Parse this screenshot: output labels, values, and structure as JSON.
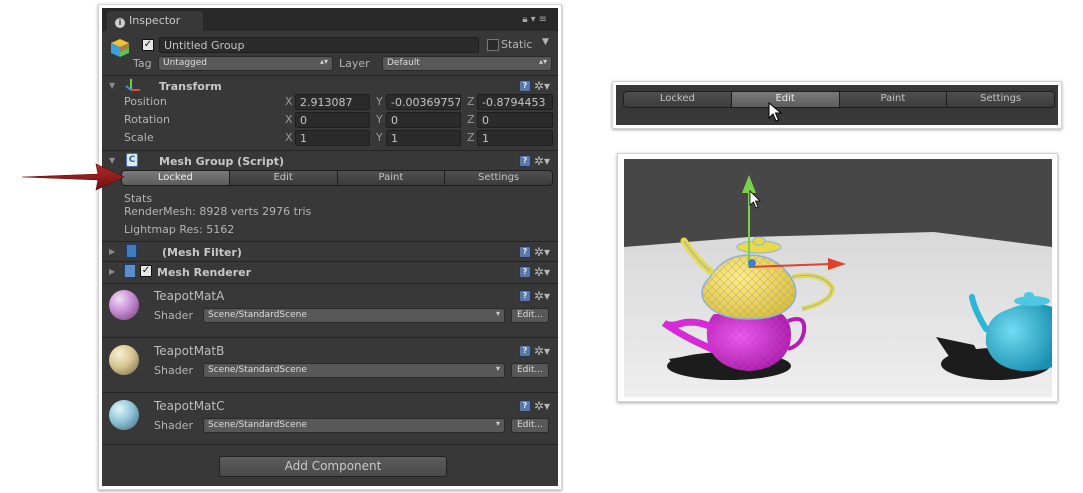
{
  "inspector": {
    "tab_label": "Inspector",
    "gameobject": {
      "name": "Untitled Group",
      "static_label": "Static",
      "tag_label": "Tag",
      "tag_value": "Untagged",
      "layer_label": "Layer",
      "layer_value": "Default"
    },
    "transform": {
      "title": "Transform",
      "position_label": "Position",
      "rotation_label": "Rotation",
      "scale_label": "Scale",
      "axis_x": "X",
      "axis_y": "Y",
      "axis_z": "Z",
      "position": {
        "x": "2.913087",
        "y": "-0.00369757",
        "z": "-0.8794453"
      },
      "rotation": {
        "x": "0",
        "y": "0",
        "z": "0"
      },
      "scale": {
        "x": "1",
        "y": "1",
        "z": "1"
      }
    },
    "mesh_group": {
      "title": "Mesh Group (Script)",
      "modes": [
        "Locked",
        "Edit",
        "Paint",
        "Settings"
      ],
      "active_mode": "Locked",
      "stats_label": "Stats",
      "render_mesh": "RenderMesh: 8928 verts 2976 tris",
      "lightmap_res": "Lightmap Res: 5162"
    },
    "mesh_filter": {
      "title": "(Mesh Filter)"
    },
    "mesh_renderer": {
      "title": "Mesh Renderer"
    },
    "materials": [
      {
        "name": "TeapotMatA",
        "shader_label": "Shader",
        "shader": "Scene/StandardScene",
        "edit_label": "Edit...",
        "color": "#c58cd2"
      },
      {
        "name": "TeapotMatB",
        "shader_label": "Shader",
        "shader": "Scene/StandardScene",
        "edit_label": "Edit...",
        "color": "#d6c690"
      },
      {
        "name": "TeapotMatC",
        "shader_label": "Shader",
        "shader": "Scene/StandardScene",
        "edit_label": "Edit...",
        "color": "#8fc5d8"
      }
    ],
    "add_component_label": "Add Component"
  },
  "mode_toolbar": {
    "modes": [
      "Locked",
      "Edit",
      "Paint",
      "Settings"
    ],
    "active_mode": "Edit"
  },
  "icons": [
    "info-icon",
    "lock-icon",
    "menu-icon",
    "gameobject-cube-icon",
    "transform-axes-icon",
    "script-icon",
    "mesh-filter-icon",
    "mesh-renderer-icon",
    "help-icon",
    "gear-icon",
    "mouse-cursor-icon",
    "red-arrow-icon"
  ],
  "colors": {
    "panel_bg": "#383838",
    "arrow_red": "#8b1a1a",
    "teapot_yellow": "#e8d84a",
    "teapot_magenta": "#d62ad6",
    "teapot_cyan": "#2ab6d6"
  }
}
